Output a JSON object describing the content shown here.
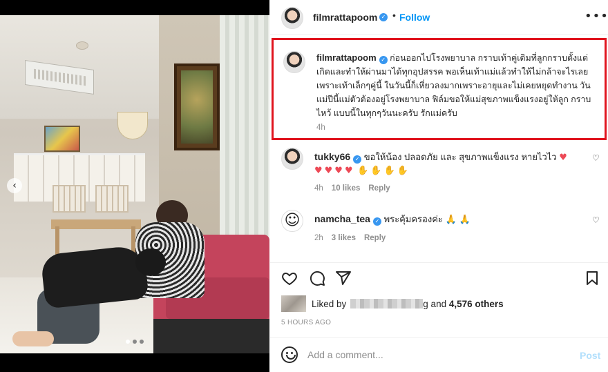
{
  "post": {
    "username": "filmrattapoom",
    "verified_mark": "✓",
    "follow_label": "Follow",
    "separator": "•",
    "more_label": "•••",
    "carousel_prev": "‹",
    "caption": "ก่อนออกไปโรงพยาบาล กราบเท้าคู่เดิมที่ลูกกราบตั้งแต่เกิดและทำให้ผ่านมาได้ทุกอุปสรรค พอเห็นเท้าแม่แล้วทำให้ไม่กล้าจะไรเลย เพราะเท้าเล็กๆคู่นี้ ในวันนี้ก็เหี่ยวลงมากเพราะอายุและไม่เคยหยุดทำงาน วันแม่ปีนี้แม่ตัวต้องอยู่โรงพยาบาล ฟิล์มขอให้แม่สุขภาพแข็งแรงอยู่ให้ลูก กราบ ไหว้ แบบนี้ในทุกๆวันนะครับ รักแม่ครับ",
    "caption_time": "4h"
  },
  "comments": [
    {
      "username": "tukky66",
      "text": "ขอให้น้อง ปลอดภัย และ สุขภาพแข็งแรง หายไวไว",
      "text_emoji": "♥",
      "emoji_line_hearts": "♥♥♥♥",
      "emoji_line_hands": "✋✋✋✋",
      "time": "4h",
      "likes": "10 likes",
      "reply": "Reply",
      "like_icon": "♡"
    },
    {
      "username": "namcha_tea",
      "avatar_glyph": "☺",
      "text": "พระคุ้มครองค่ะ",
      "text_emoji": "🙏 🙏",
      "time": "2h",
      "likes": "3 likes",
      "reply": "Reply",
      "like_icon": "♡"
    }
  ],
  "likes": {
    "prefix": "Liked by",
    "suffix": "g and",
    "count": "4,576 others"
  },
  "posted_ago": "5 HOURS AGO",
  "comment_box": {
    "placeholder": "Add a comment...",
    "post_label": "Post"
  },
  "colors": {
    "accent": "#0095f6",
    "verified": "#3897f0",
    "highlight_border": "#e0141e",
    "heart": "#ed4956"
  }
}
